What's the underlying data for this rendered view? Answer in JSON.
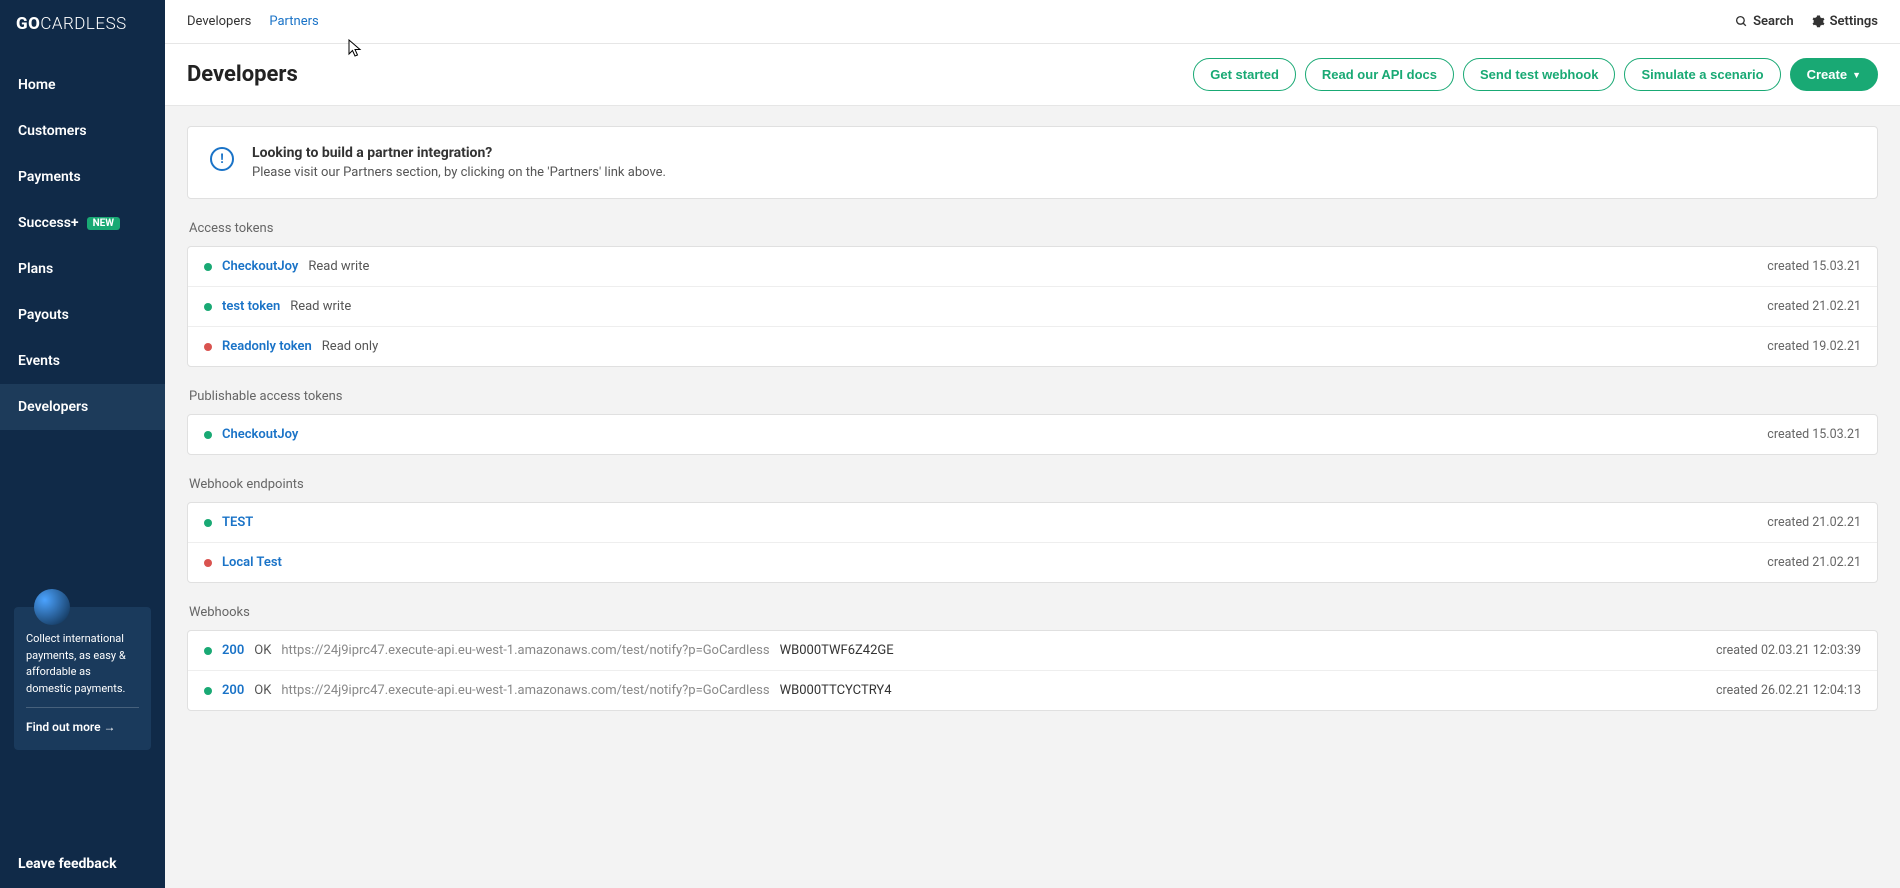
{
  "brand": {
    "go": "GO",
    "cardless": "CARDLESS"
  },
  "sidebar": {
    "items": [
      {
        "label": "Home"
      },
      {
        "label": "Customers"
      },
      {
        "label": "Payments"
      },
      {
        "label": "Success+",
        "badge": "NEW"
      },
      {
        "label": "Plans"
      },
      {
        "label": "Payouts"
      },
      {
        "label": "Events"
      },
      {
        "label": "Developers",
        "active": true
      }
    ],
    "promo": {
      "text": "Collect international payments, as easy & affordable as domestic payments.",
      "cta": "Find out more →"
    },
    "feedback": "Leave feedback"
  },
  "topbar": {
    "tabs": [
      {
        "label": "Developers"
      },
      {
        "label": "Partners",
        "link": true
      }
    ],
    "search": "Search",
    "settings": "Settings"
  },
  "header": {
    "title": "Developers",
    "actions": {
      "get_started": "Get started",
      "read_docs": "Read our API docs",
      "send_webhook": "Send test webhook",
      "simulate": "Simulate a scenario",
      "create": "Create"
    }
  },
  "info_banner": {
    "title": "Looking to build a partner integration?",
    "desc": "Please visit our Partners section, by clicking on the 'Partners' link above."
  },
  "sections": {
    "access_tokens": {
      "title": "Access tokens",
      "rows": [
        {
          "status": "green",
          "name": "CheckoutJoy",
          "perm": "Read write",
          "meta": "created 15.03.21"
        },
        {
          "status": "green",
          "name": "test token",
          "perm": "Read write",
          "meta": "created 21.02.21"
        },
        {
          "status": "red",
          "name": "Readonly token",
          "perm": "Read only",
          "meta": "created 19.02.21"
        }
      ]
    },
    "publishable": {
      "title": "Publishable access tokens",
      "rows": [
        {
          "status": "green",
          "name": "CheckoutJoy",
          "meta": "created 15.03.21"
        }
      ]
    },
    "webhook_endpoints": {
      "title": "Webhook endpoints",
      "rows": [
        {
          "status": "green",
          "name": "TEST",
          "meta": "created 21.02.21"
        },
        {
          "status": "red",
          "name": "Local Test",
          "meta": "created 21.02.21"
        }
      ]
    },
    "webhooks": {
      "title": "Webhooks",
      "rows": [
        {
          "status": "green",
          "code": "200",
          "status_text": "OK",
          "url": "https://24j9iprc47.execute-api.eu-west-1.amazonaws.com/test/notify?p=GoCardless",
          "id": "WB000TWF6Z42GE",
          "meta": "created 02.03.21 12:03:39"
        },
        {
          "status": "green",
          "code": "200",
          "status_text": "OK",
          "url": "https://24j9iprc47.execute-api.eu-west-1.amazonaws.com/test/notify?p=GoCardless",
          "id": "WB000TTCYCTRY4",
          "meta": "created 26.02.21 12:04:13"
        }
      ]
    }
  }
}
